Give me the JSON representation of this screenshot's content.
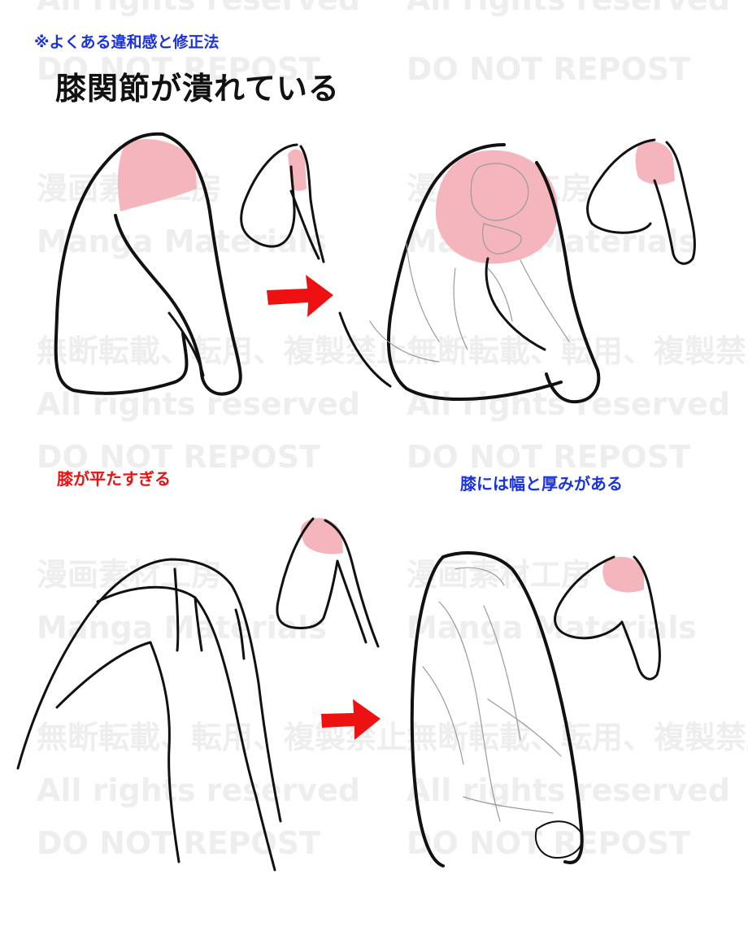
{
  "header": {
    "subtitle": "※よくある違和感と修正法",
    "title": "膝関節が潰れている"
  },
  "captions": {
    "wrong": "膝が平たすぎる",
    "right": "膝には幅と厚みがある"
  },
  "watermark": {
    "studio": "漫画素材工房",
    "brand": "Manga Materials",
    "notice_jp": "無断転載、転用、複製禁止",
    "rights": "All rights reserved",
    "repost": "DO NOT REPOST"
  },
  "colors": {
    "subtitle": "#1a33dd",
    "caption_wrong": "#ee1111",
    "caption_right": "#1a33dd",
    "arrow": "#ee1111",
    "knee_highlight": "#f5b5bc",
    "watermark": "#eeeeee"
  },
  "icons": {
    "arrow": "right-arrow-icon"
  }
}
